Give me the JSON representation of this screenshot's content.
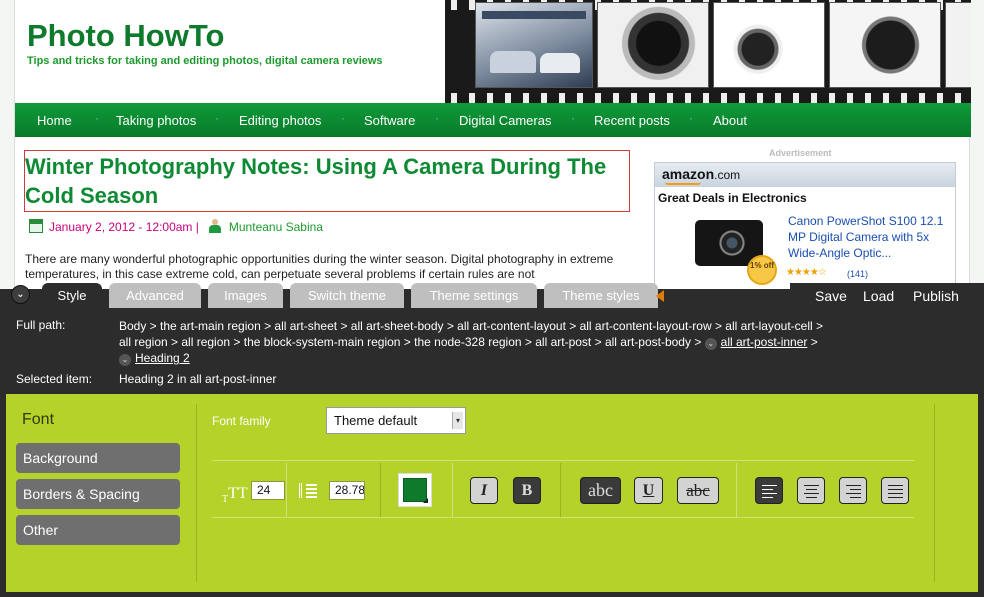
{
  "site": {
    "title": "Photo HowTo",
    "slogan": "Tips and tricks for taking and editing photos, digital camera reviews",
    "nav": [
      "Home",
      "Taking photos",
      "Editing photos",
      "Software",
      "Digital Cameras",
      "Recent posts",
      "About"
    ]
  },
  "post": {
    "title": "Winter Photography Notes: Using A Camera During The Cold Season",
    "date": "January 2, 2012 - 12:00am |",
    "author": "Munteanu Sabina",
    "body": "There are many wonderful photographic opportunities during the winter season. Digital photography in extreme temperatures, in this case extreme cold, can perpetuate several problems if certain rules are not"
  },
  "ad": {
    "label": "Advertisement",
    "logo": "amazon",
    "logo_suffix": ".com",
    "heading": "Great Deals in Electronics",
    "product": "Canon PowerShot S100 12.1 MP Digital Camera with 5x Wide-Angle Optic...",
    "discount": "1% off",
    "stars": "★★★★☆",
    "reviews": "(141)"
  },
  "editor": {
    "tabs": [
      "Style",
      "Advanced",
      "Images",
      "Switch theme",
      "Theme settings",
      "Theme styles"
    ],
    "active_tab": "Style",
    "actions": [
      "Save",
      "Load",
      "Publish"
    ],
    "full_path_label": "Full path:",
    "full_path_line1": "Body > the art-main region > all art-sheet > all art-sheet-body > all art-content-layout > all art-content-layout-row > all art-layout-cell >",
    "full_path_line2": "all region > all region > the block-system-main region > the node-328 region > all art-post > all art-post-body >",
    "full_path_link1": "all art-post-inner",
    "full_path_link1_suffix": " >",
    "full_path_link2": "Heading 2",
    "selected_label": "Selected item:",
    "selected_value": "Heading 2 in all art-post-inner",
    "categories_title": "Font",
    "categories": [
      "Background",
      "Borders & Spacing",
      "Other"
    ],
    "font_family_label": "Font family",
    "font_family_value": "Theme default",
    "font_size": "24",
    "line_height": "28.78",
    "font_size_icon": "TT",
    "text_color": "#0d7a2c",
    "format_buttons": [
      "I",
      "B",
      "abc",
      "U",
      "abc"
    ]
  },
  "colors": {
    "brand_green": "#0d7a2c",
    "nav_green": "#0f9a3a",
    "panel_dark": "#2c2c2c",
    "panel_lime": "#b5d22a"
  }
}
